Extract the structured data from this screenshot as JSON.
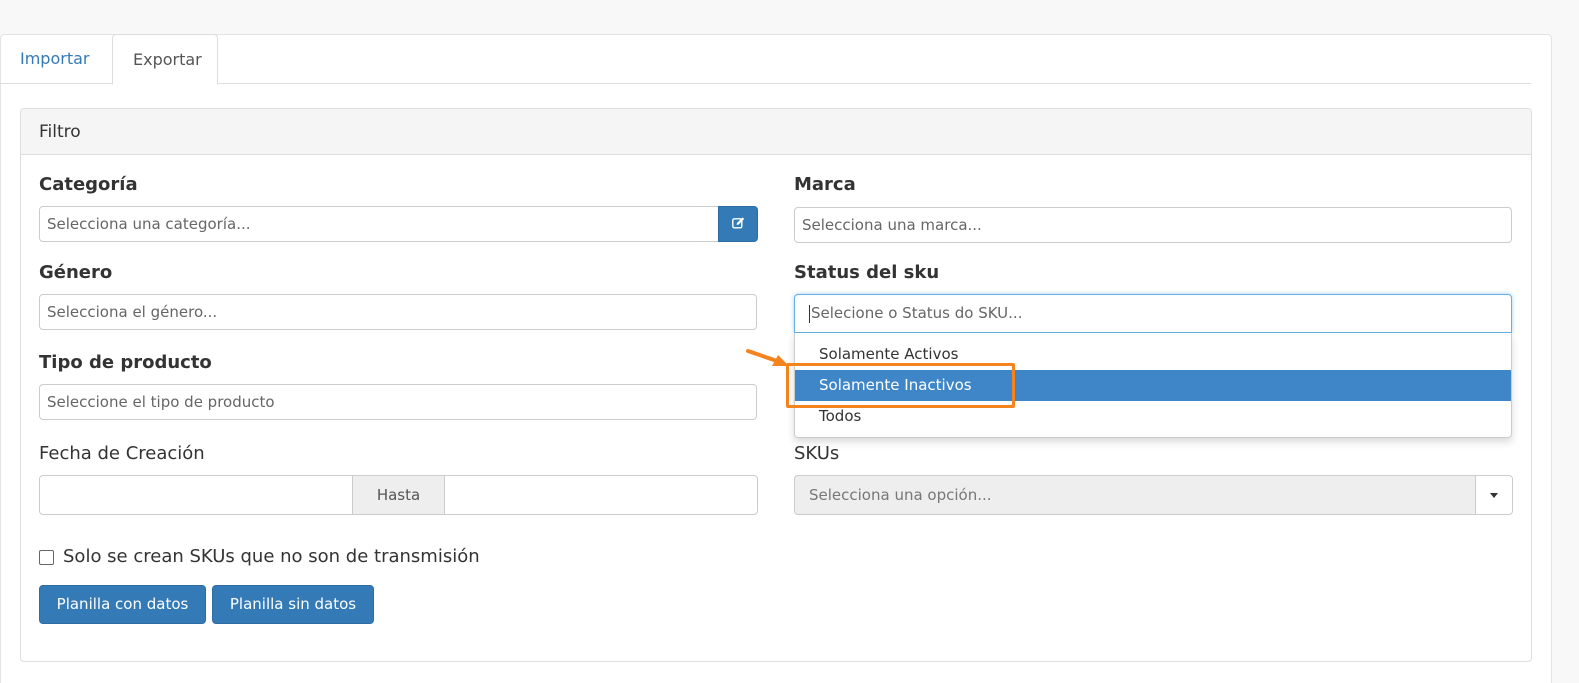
{
  "tabs": [
    {
      "label": "Importar",
      "active": false
    },
    {
      "label": "Exportar",
      "active": true
    }
  ],
  "panel": {
    "title": "Filtro"
  },
  "fields": {
    "categoria": {
      "label": "Categoría",
      "placeholder": "Selecciona una categoría..."
    },
    "marca": {
      "label": "Marca",
      "placeholder": "Selecciona una marca..."
    },
    "genero": {
      "label": "Género",
      "placeholder": "Selecciona el género..."
    },
    "status": {
      "label": "Status del sku",
      "placeholder": "Selecione o Status do SKU..."
    },
    "tipo": {
      "label": "Tipo de producto",
      "placeholder": "Seleccione el tipo de producto"
    },
    "fecha": {
      "label": "Fecha de Creación",
      "addon": "Hasta"
    },
    "skus": {
      "label": "SKUs",
      "placeholder": "Selecciona una opción..."
    }
  },
  "status_dropdown": {
    "options": [
      "Solamente Activos",
      "Solamente Inactivos",
      "Todos"
    ],
    "highlighted": "Solamente Inactivos"
  },
  "checkbox": {
    "label": "Solo se crean SKUs que no son de transmisión",
    "checked": false
  },
  "buttons": {
    "with_data": "Planilla con datos",
    "without_data": "Planilla sin datos"
  },
  "colors": {
    "primary": "#337ab7",
    "highlight": "#3f86c8",
    "callout": "#f5841f"
  },
  "icons": {
    "edit": "edit-icon",
    "caret": "chevron-down-icon",
    "annotation": "arrow-icon"
  }
}
